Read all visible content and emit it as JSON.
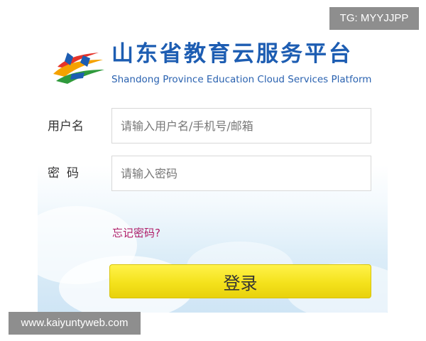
{
  "header": {
    "title_cn": "山东省教育云服务平台",
    "title_en": "Shandong Province Education Cloud Services Platform",
    "logo_icon": "shandong-edu-cloud-logo-icon"
  },
  "form": {
    "username": {
      "label": "用户名",
      "value": "",
      "placeholder": "请输入用户名/手机号/邮箱"
    },
    "password": {
      "label": "密码",
      "value": "",
      "placeholder": "请输入密码"
    },
    "forgot_link": "忘记密码?",
    "login_button": "登录"
  },
  "overlays": {
    "tg_tag": "TG: MYYJJPP",
    "site_tag": "www.kaiyuntyweb.com"
  },
  "colors": {
    "brand_blue": "#1d5db2",
    "button_yellow": "#f4e21c",
    "link_magenta": "#b01e68",
    "tag_gray": "#8e8e8e"
  }
}
